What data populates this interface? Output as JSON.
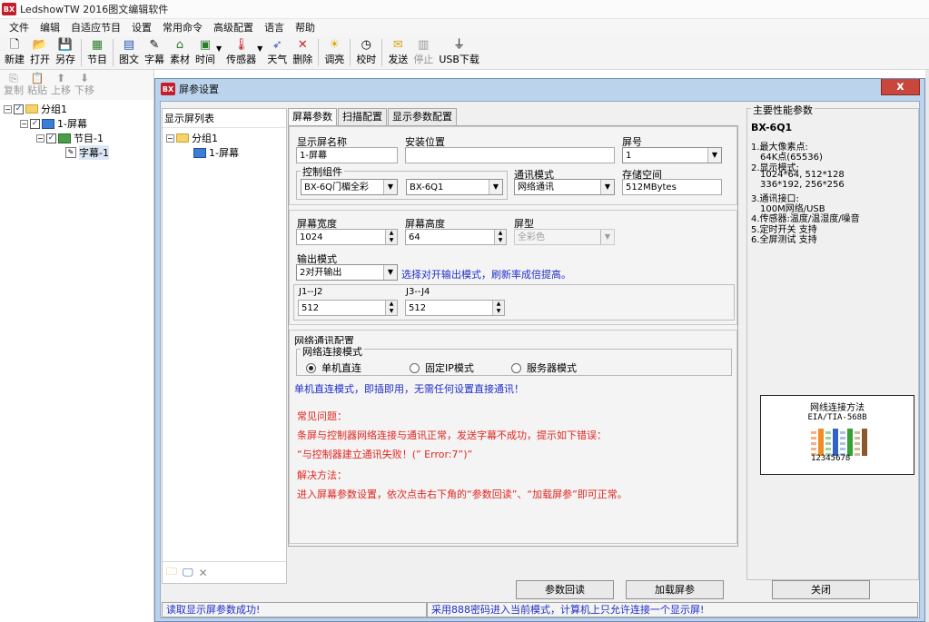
{
  "app": {
    "title": "LedshowTW 2016图文编辑软件",
    "logo_text": "BX"
  },
  "menu": [
    "文件",
    "编辑",
    "自适应节目",
    "设置",
    "常用命令",
    "高级配置",
    "语言",
    "帮助"
  ],
  "toolbar": {
    "new": "新建",
    "open": "打开",
    "save_as": "另存",
    "program": "节目",
    "graphic": "图文",
    "subtitle": "字幕",
    "material": "素材",
    "time": "时间",
    "sensor": "传感器",
    "weather": "天气",
    "delete": "删除",
    "brightness": "调亮",
    "timing": "校时",
    "send": "发送",
    "stop": "停止",
    "usb": "USB下载"
  },
  "edit_toolbar": {
    "copy": "复制",
    "paste": "粘贴",
    "up": "上移",
    "down": "下移"
  },
  "tree": {
    "group": "分组1",
    "screen": "1-屏幕",
    "program": "节目-1",
    "subtitle": "字幕-1"
  },
  "dialog": {
    "title": "屏参设置",
    "close": "x",
    "screen_list": {
      "title": "显示屏列表",
      "group": "分组1",
      "screen": "1-屏幕"
    },
    "tabs": [
      "屏幕参数",
      "扫描配置",
      "显示参数配置"
    ],
    "screen_params": {
      "name_label": "显示屏名称",
      "name_value": "1-屏幕",
      "location_label": "安装位置",
      "location_value": "",
      "number_label": "屏号",
      "number_value": "1",
      "control_label": "控制组件",
      "control_series": "BX-6Q门楣全彩",
      "control_model": "BX-6Q1",
      "comm_label": "通讯模式",
      "comm_value": "网络通讯",
      "storage_label": "存储空间",
      "storage_value": "512MBytes",
      "width_label": "屏幕宽度",
      "width_value": "1024",
      "height_label": "屏幕高度",
      "height_value": "64",
      "type_label": "屏型",
      "type_value": "全彩色",
      "output_label": "输出模式",
      "output_value": "2对开输出",
      "output_hint": "选择对开输出模式，刷新率成倍提高。",
      "j1_label": "J1--J2",
      "j1_value": "512",
      "j3_label": "J3--J4",
      "j3_value": "512"
    },
    "network": {
      "title": "网络通讯配置",
      "mode_label": "网络连接模式",
      "modes": [
        "单机直连",
        "固定IP模式",
        "服务器模式"
      ],
      "selected": 0,
      "hint": "单机直连模式，即插即用，无需任何设置直接通讯！",
      "faq": [
        "常见问题：",
        "条屏与控制器网络连接与通讯正常，发送字幕不成功，提示如下错误：",
        "“与控制器建立通讯失败！(” Error:7”)”",
        "解决方法：",
        "进入屏幕参数设置，依次点击右下角的“参数回读”、“加载屏参”即可正常。"
      ]
    },
    "performance": {
      "title": "主要性能参数",
      "model": "BX-6Q1",
      "lines": [
        "1.最大像素点:",
        "64K点(65536)",
        "2.显示模式:",
        "1024*64, 512*128",
        "336*192, 256*256",
        "3.通讯接口:",
        "100M网络/USB",
        "4.传感器:温度/温湿度/噪音",
        "5.定时开关 支持",
        "6.全屏测试 支持"
      ],
      "cable_title": "网线连接方法",
      "cable_sub": "EIA/TIA-568B",
      "pins": "12345678",
      "wire_colors": [
        "#f4b183",
        "#f28c28",
        "#9ad29a",
        "#2f63c9",
        "#a9c3ee",
        "#35a035",
        "#d6b99a",
        "#8a5a2b"
      ]
    },
    "buttons": {
      "readback": "参数回读",
      "load": "加载屏参",
      "close": "关闭"
    },
    "status": [
      "读取显示屏参数成功!",
      "采用888密码进入当前模式，计算机上只允许连接一个显示屏!"
    ]
  },
  "colors": {
    "dialog_frame": "#bcd3ec",
    "hint_blue": "#1f2fc8",
    "faq_red": "#e0261f"
  }
}
